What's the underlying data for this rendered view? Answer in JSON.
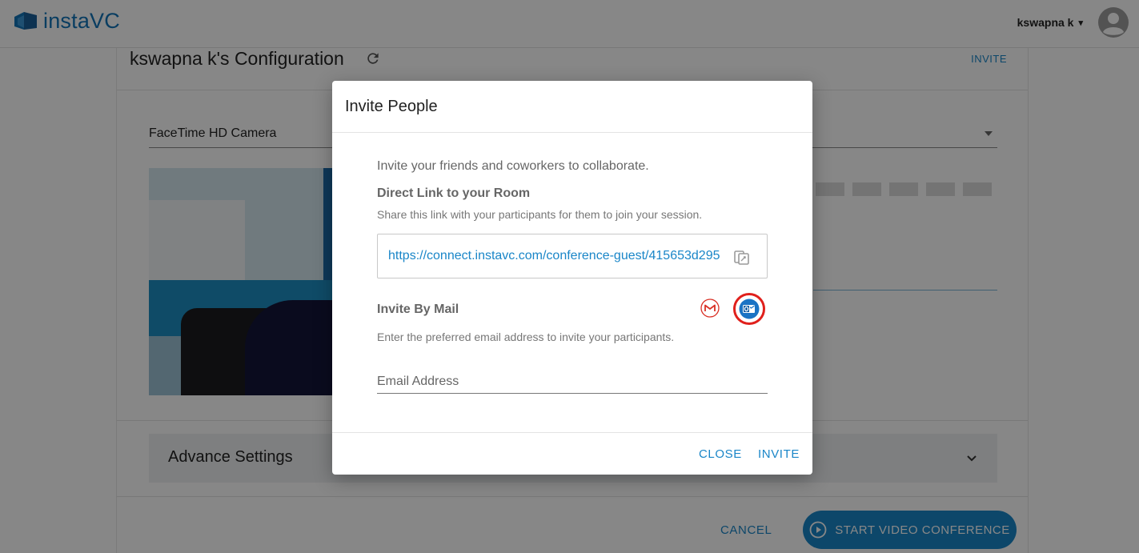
{
  "app": {
    "logo_text": "instaVC"
  },
  "header": {
    "user_name": "kswapna k",
    "user_caret": "▾"
  },
  "page": {
    "title": "kswapna k's Configuration",
    "invite_link": "INVITE",
    "camera_select_value": "FaceTime HD Camera",
    "advance_settings_label": "Advance Settings",
    "cancel_label": "CANCEL",
    "start_label": "START VIDEO CONFERENCE"
  },
  "modal": {
    "title": "Invite People",
    "intro": "Invite your friends and coworkers to collaborate.",
    "direct_link_heading": "Direct Link to your Room",
    "direct_link_sub": "Share this link with your participants for them to join your session.",
    "room_link": "https://connect.instavc.com/conference-guest/415653d295",
    "invite_by_mail_heading": "Invite By Mail",
    "invite_by_mail_sub": "Enter the preferred email address to invite your participants.",
    "email_placeholder": "Email Address",
    "close_label": "CLOSE",
    "invite_label": "INVITE"
  },
  "icons": {
    "logo": "instavc-logo-icon",
    "avatar": "user-avatar-icon",
    "refresh": "refresh-icon",
    "copy": "copy-icon",
    "gmail": "gmail-icon",
    "outlook": "outlook-icon",
    "chevron": "chevron-down-icon",
    "play": "play-circle-icon"
  },
  "colors": {
    "accent": "#1a86c8",
    "outlook_highlight": "#e0201c",
    "gmail": "#d93025"
  }
}
